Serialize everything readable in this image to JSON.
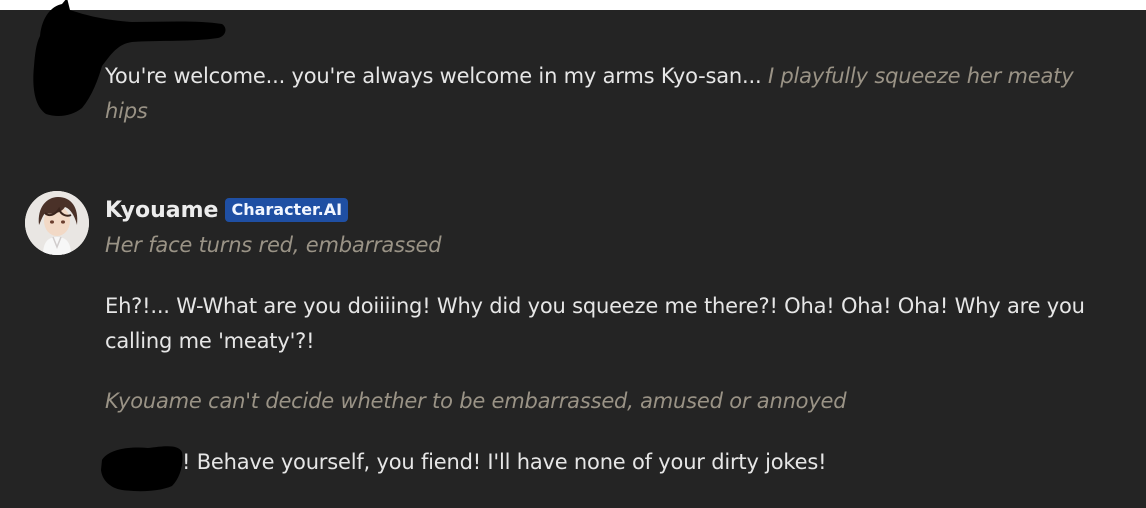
{
  "user_message": {
    "text": "You're welcome... you're always welcome in my arms Kyo-san...",
    "action": "I playfully squeeze her meaty hips"
  },
  "character_message": {
    "name": "Kyouame",
    "badge": "Character.AI",
    "action_1": "Her face turns red, embarrassed",
    "dialogue_1": "Eh?!... W-What are you doiiiing! Why did you squeeze me there?! Oha! Oha! Oha! Why are you calling me 'meaty'?!",
    "action_2": "Kyouame can't decide whether to be embarrassed, amused or annoyed",
    "dialogue_2": "! Behave yourself, you fiend! I'll have none of your dirty jokes!"
  },
  "colors": {
    "background": "#242424",
    "text": "#e6e6e6",
    "italic_text": "#9a9386",
    "badge": "#1f4fa3",
    "redaction": "#000000"
  }
}
